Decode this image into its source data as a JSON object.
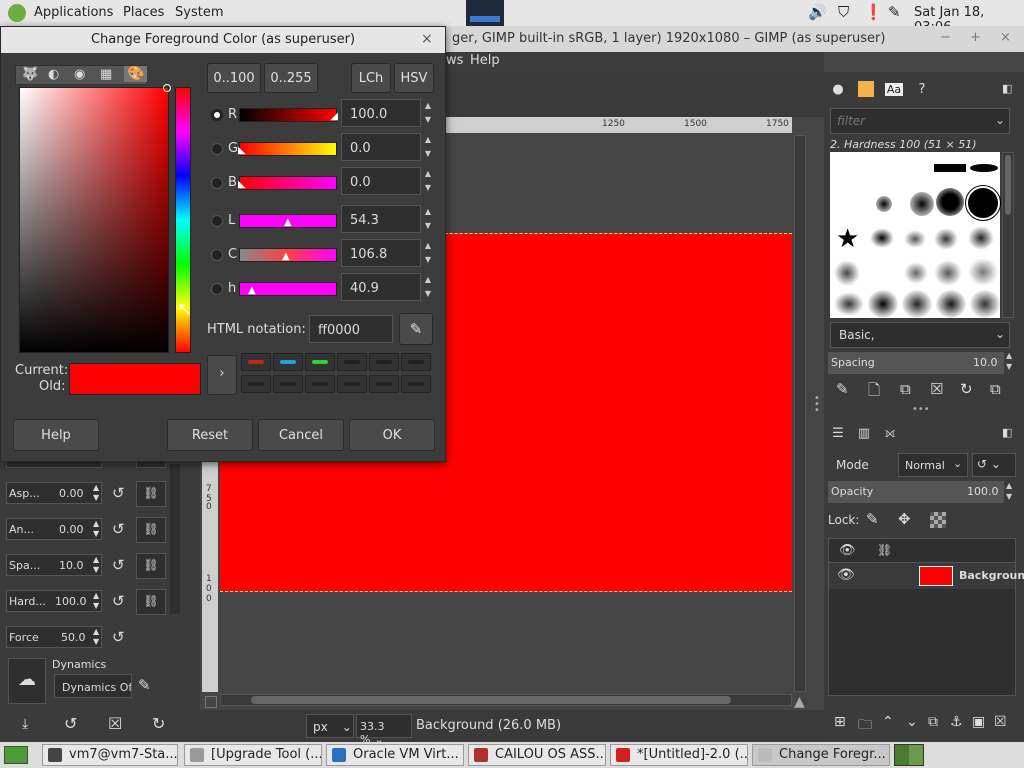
{
  "top_panel": {
    "applications": "Applications",
    "places": "Places",
    "system": "System",
    "clock": "Sat Jan 18, 03:06"
  },
  "gimp_window": {
    "title": "ger, GIMP built-in sRGB, 1 layer) 1920x1080 – GIMP (as superuser)",
    "menu_ws": "ws",
    "menu_help": "Help"
  },
  "rulers": {
    "h": [
      "1250",
      "1500",
      "1750"
    ],
    "v": [
      "7",
      "5",
      "0",
      "1",
      "0",
      "0"
    ]
  },
  "dialog": {
    "title": "Change Foreground Color (as superuser)",
    "range_buttons": [
      "0..100",
      "0..255",
      "LCh",
      "HSV"
    ],
    "channels": [
      {
        "label": "R",
        "value": "100.0",
        "selected": true
      },
      {
        "label": "G",
        "value": "0.0",
        "selected": false
      },
      {
        "label": "B",
        "value": "0.0",
        "selected": false
      },
      {
        "label": "L",
        "value": "54.3",
        "selected": false
      },
      {
        "label": "C",
        "value": "106.8",
        "selected": false
      },
      {
        "label": "h",
        "value": "40.9",
        "selected": false
      }
    ],
    "html_notation_label": "HTML notation:",
    "html_notation_value": "ff0000",
    "current_label": "Current:",
    "old_label": "Old:",
    "current_color": "#ff0000",
    "history_colors": [
      "#cc2222",
      "#2aa0dd",
      "#33cc33"
    ],
    "buttons": {
      "help": "Help",
      "reset": "Reset",
      "cancel": "Cancel",
      "ok": "OK"
    }
  },
  "tool_options": [
    {
      "label": "Asp...",
      "value": "0.00"
    },
    {
      "label": "An...",
      "value": "0.00"
    },
    {
      "label": "Spa...",
      "value": "10.0"
    },
    {
      "label": "Hard...",
      "value": "100.0"
    },
    {
      "label": "Force",
      "value": "50.0"
    }
  ],
  "dynamics": {
    "label": "Dynamics",
    "value": "Dynamics Of"
  },
  "status": {
    "unit": "px",
    "zoom": "33.3 %",
    "message": "Background (26.0 MB)"
  },
  "brushes": {
    "filter_placeholder": "filter",
    "brush_name": "2. Hardness 100 (51 × 51)",
    "preset": "Basic,",
    "spacing_label": "Spacing",
    "spacing_value": "10.0"
  },
  "layers": {
    "mode_label": "Mode",
    "mode_value": "Normal",
    "opacity_label": "Opacity",
    "opacity_value": "100.0",
    "lock_label": "Lock:",
    "layer_name": "Backgroun"
  },
  "taskbar": [
    {
      "label": "vm7@vm7-Sta...",
      "color": "#444"
    },
    {
      "label": "[Upgrade Tool (...",
      "color": "#999"
    },
    {
      "label": "Oracle VM Virt...",
      "color": "#2a6fc0"
    },
    {
      "label": "CAILOU OS ASS...",
      "color": "#b03030"
    },
    {
      "label": "*[Untitled]-2.0 (...",
      "color": "#d02020"
    },
    {
      "label": "Change Foregr...",
      "color": "#bbb"
    }
  ]
}
